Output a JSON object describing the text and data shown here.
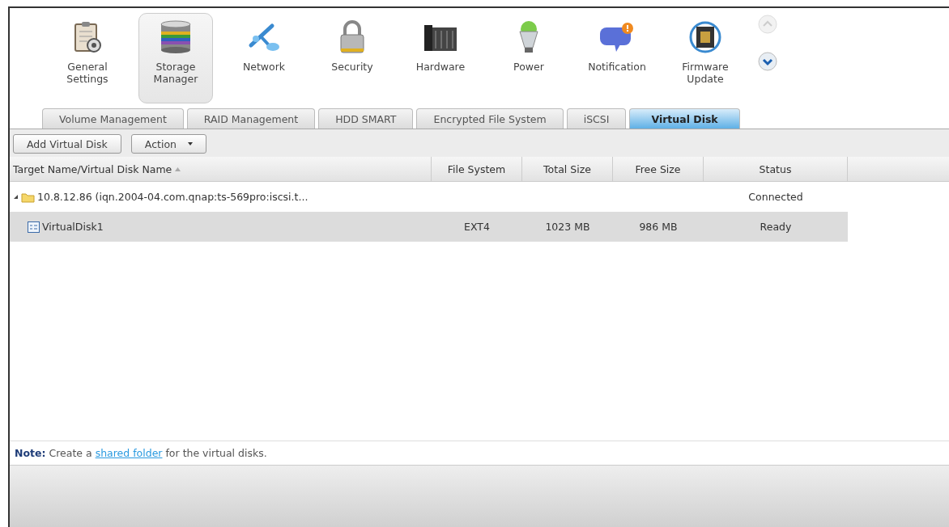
{
  "nav_items": [
    {
      "label": "General\nSettings",
      "selected": false
    },
    {
      "label": "Storage\nManager",
      "selected": true
    },
    {
      "label": "Network",
      "selected": false
    },
    {
      "label": "Security",
      "selected": false
    },
    {
      "label": "Hardware",
      "selected": false
    },
    {
      "label": "Power",
      "selected": false
    },
    {
      "label": "Notification",
      "selected": false
    },
    {
      "label": "Firmware\nUpdate",
      "selected": false
    }
  ],
  "tabs": [
    {
      "label": "Volume Management",
      "selected": false
    },
    {
      "label": "RAID Management",
      "selected": false
    },
    {
      "label": "HDD SMART",
      "selected": false
    },
    {
      "label": "Encrypted File System",
      "selected": false
    },
    {
      "label": "iSCSI",
      "selected": false
    },
    {
      "label": "Virtual Disk",
      "selected": true
    }
  ],
  "toolbar": {
    "add_button": "Add Virtual Disk",
    "action_button": "Action"
  },
  "table": {
    "columns": [
      "Target Name/Virtual Disk Name",
      "File System",
      "Total Size",
      "Free Size",
      "Status"
    ],
    "rows": [
      {
        "kind": "target",
        "cells": [
          "10.8.12.86 (iqn.2004-04.com.qnap:ts-569pro:iscsi.t...",
          "",
          "",
          "",
          "Connected"
        ],
        "expanded": true,
        "selected": false,
        "children": [
          {
            "kind": "disk",
            "cells": [
              "VirtualDisk1",
              "EXT4",
              "1023 MB",
              "986 MB",
              "Ready"
            ],
            "selected": true
          }
        ]
      }
    ]
  },
  "note": {
    "label": "Note:",
    "before": "Create a ",
    "link": "shared folder",
    "after": " for the virtual disks."
  }
}
